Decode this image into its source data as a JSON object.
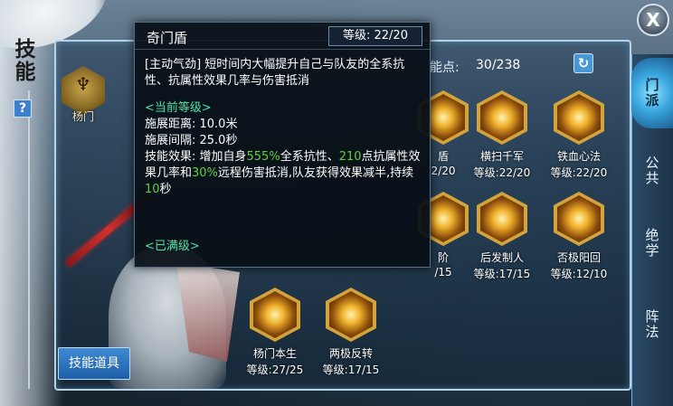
{
  "page": {
    "title": "技能",
    "help_label": "?"
  },
  "faction": {
    "emblem_glyph": "♆",
    "name": "杨门"
  },
  "points": {
    "label": "能点:",
    "value": "30/238"
  },
  "refresh_icon": "↻",
  "skills": [
    {
      "name": "盾",
      "level": "2/20",
      "icon": "shield-icon"
    },
    {
      "name": "横扫千军",
      "level": "等级:22/20",
      "icon": "sweep-icon"
    },
    {
      "name": "铁血心法",
      "level": "等级:22/20",
      "icon": "warrior-icon"
    },
    {
      "name": "阶",
      "level": "/15",
      "icon": "step-icon"
    },
    {
      "name": "后发制人",
      "level": "等级:17/15",
      "icon": "counter-icon"
    },
    {
      "name": "否极阳回",
      "level": "等级:12/10",
      "icon": "sun-icon"
    },
    {
      "name": "杨门本生",
      "level": "等级:27/25",
      "icon": "clan-icon"
    },
    {
      "name": "两极反转",
      "level": "等级:17/15",
      "icon": "reverse-icon"
    }
  ],
  "items_button": "技能道具",
  "close_label": "X",
  "tabs": [
    {
      "label": "门派",
      "active": true
    },
    {
      "label": "公共",
      "active": false
    },
    {
      "label": "绝学",
      "active": false
    },
    {
      "label": "阵法",
      "active": false
    }
  ],
  "tooltip": {
    "title": "奇门盾",
    "level": "等级: 22/20",
    "type_tag": "[主动气劲]",
    "description": "短时间内大幅提升自己与队友的全系抗性、抗属性效果几率与伤害抵消",
    "current_header": "<当前等级>",
    "range": "施展距离: 10.0米",
    "interval": "施展间隔: 25.0秒",
    "effect_prefix": "技能效果: 增加自身",
    "effect_v1": "555%",
    "effect_t1": "全系抗性、",
    "effect_v2": "210",
    "effect_t2": "点抗属性效果几率和",
    "effect_v3": "30%",
    "effect_t3": "远程伤害抵消,队友获得效果减半,持续",
    "effect_v4": "10",
    "effect_t4": "秒",
    "max_label": "<已满级>"
  }
}
